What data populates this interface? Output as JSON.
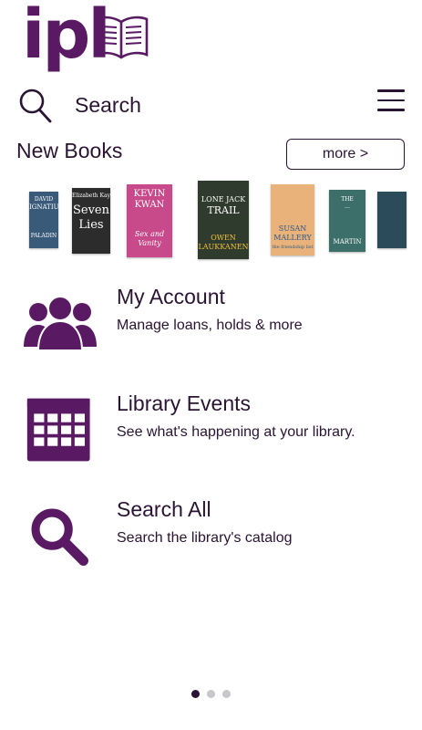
{
  "logo": {
    "text": "ipl",
    "icon": "open-book-icon"
  },
  "search": {
    "label": "Search",
    "icon": "search-icon"
  },
  "menu": {
    "icon": "hamburger-menu-icon"
  },
  "new_books": {
    "title": "New Books",
    "more_label": "more >",
    "books": [
      {
        "line1": "DAVID",
        "line2": "IGNATIUS",
        "line3": "PALADIN",
        "color": "#3a5a7a"
      },
      {
        "line1": "Elizabeth Kay",
        "line2": "Seven",
        "line3": "Lies",
        "color": "#2c2c2c"
      },
      {
        "line1": "KEVIN",
        "line2": "KWAN",
        "line3": "Sex and Vanity",
        "color": "#c94a8a"
      },
      {
        "line1": "LONE JACK",
        "line2": "TRAIL",
        "line3": "OWEN LAUKKANEN",
        "color": "#2f3b2c"
      },
      {
        "line1": "SUSAN",
        "line2": "MALLERY",
        "line3": "the friendship list",
        "color": "#e9b27a"
      },
      {
        "line1": "THE",
        "line2": "...",
        "line3": "MARTIN",
        "color": "#3d6f6a"
      },
      {
        "line1": "",
        "line2": "",
        "line3": "",
        "color": "#2b4a5a"
      }
    ]
  },
  "items": [
    {
      "title": "My Account",
      "subtitle": "Manage loans, holds & more",
      "icon": "account-group-icon"
    },
    {
      "title": "Library Events",
      "subtitle": "See what's happening at your library.",
      "icon": "calendar-icon"
    },
    {
      "title": "Search All",
      "subtitle": "Search the library's catalog",
      "icon": "magnifier-icon"
    }
  ],
  "colors": {
    "brand": "#5a1a63",
    "text": "#2a1433"
  },
  "pager": {
    "count": 3,
    "active": 1
  }
}
